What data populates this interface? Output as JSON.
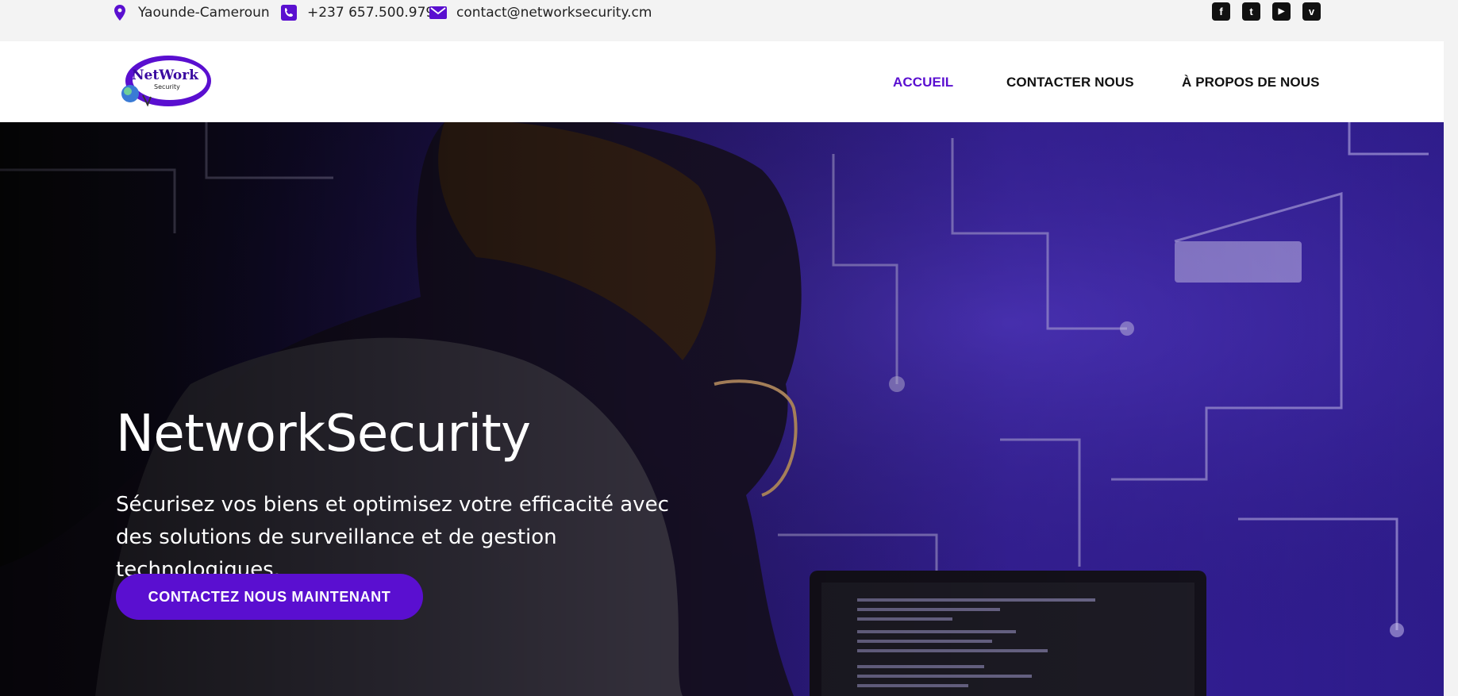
{
  "topbar": {
    "location": "Yaounde-Cameroun",
    "phone": "+237 657.500.979",
    "email": "contact@networksecurity.cm",
    "social": [
      {
        "name": "facebook-icon",
        "glyph": "f"
      },
      {
        "name": "twitter-icon",
        "glyph": "t"
      },
      {
        "name": "youtube-icon",
        "glyph": "▶"
      },
      {
        "name": "vimeo-icon",
        "glyph": "v"
      }
    ]
  },
  "logo": {
    "line1": "NetWork",
    "line2": "Security"
  },
  "nav": {
    "home": "ACCUEIL",
    "contact": "CONTACTER NOUS",
    "about": "À PROPOS DE NOUS"
  },
  "hero": {
    "title": "NetworkSecurity",
    "text": "Sécurisez vos biens et optimisez votre efficacité avec des solutions de surveillance et de gestion technologiques.",
    "cta": "CONTACTEZ NOUS MAINTENANT"
  },
  "colors": {
    "accent": "#5a0fd0",
    "topbar": "#f3f3f3",
    "nav_bg": "#ffffff"
  }
}
